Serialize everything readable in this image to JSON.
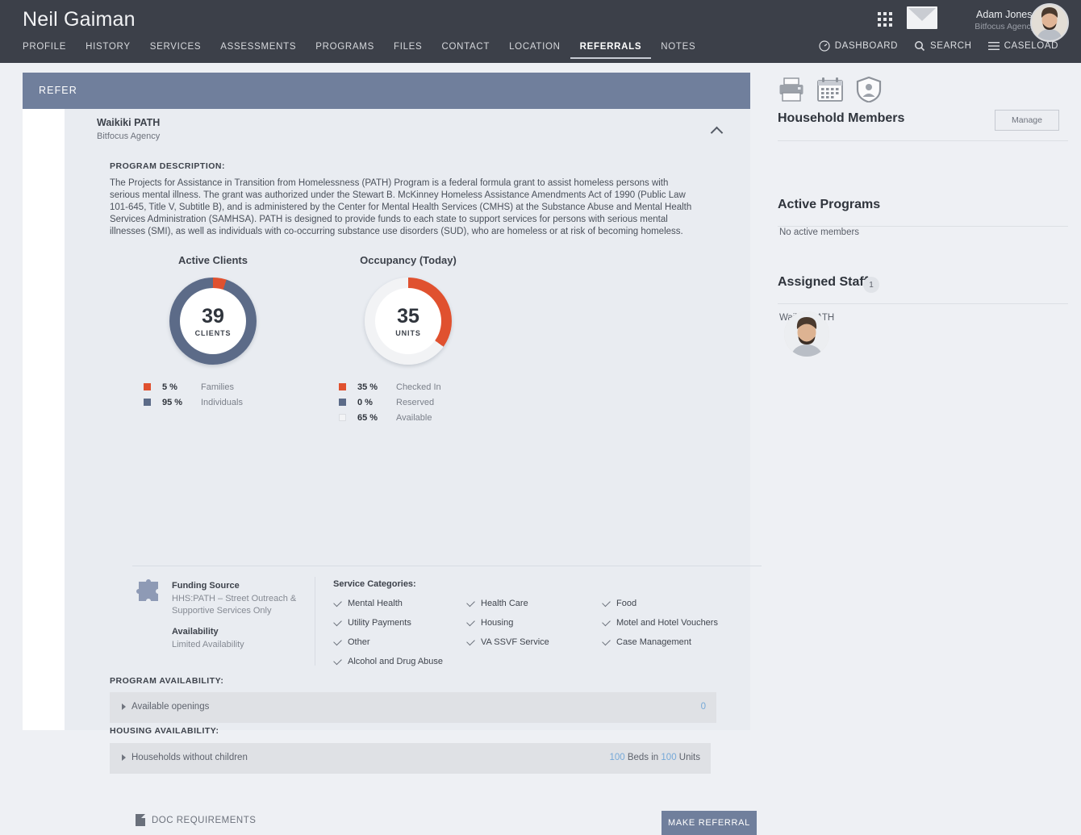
{
  "header": {
    "client_name": "Neil Gaiman",
    "nav": [
      {
        "label": "PROFILE",
        "active": false
      },
      {
        "label": "HISTORY",
        "active": false
      },
      {
        "label": "SERVICES",
        "active": false
      },
      {
        "label": "ASSESSMENTS",
        "active": false
      },
      {
        "label": "PROGRAMS",
        "active": false
      },
      {
        "label": "FILES",
        "active": false
      },
      {
        "label": "CONTACT",
        "active": false
      },
      {
        "label": "LOCATION",
        "active": false
      },
      {
        "label": "REFERRALS",
        "active": true
      },
      {
        "label": "NOTES",
        "active": false
      }
    ],
    "user": {
      "name": "Adam Jones,",
      "agency": "Bitfocus Agency"
    },
    "subnav": [
      {
        "label": "DASHBOARD",
        "icon": "dashboard-gauge-icon"
      },
      {
        "label": "SEARCH",
        "icon": "search-icon"
      },
      {
        "label": "CASELOAD",
        "icon": "hamburger-icon"
      }
    ],
    "icons": {
      "apps": "apps-grid-icon",
      "mail": "mail-envelope-icon",
      "avatar": "user-avatar"
    },
    "colors": {
      "bar_bg": "#3c4049",
      "accent": "#707f9c"
    }
  },
  "refer": {
    "bar_label": "REFER"
  },
  "program": {
    "title": "Waikiki PATH",
    "agency": "Bitfocus Agency",
    "collapse_icon": "chevron-up-icon",
    "description_label": "PROGRAM DESCRIPTION:",
    "description": "The Projects for Assistance in Transition from Homelessness (PATH) Program is a federal formula grant to assist homeless persons with serious mental illness. The grant was authorized under the Stewart B. McKinney Homeless Assistance Amendments Act of 1990 (Public Law 101-645, Title V, Subtitle B), and is administered by the Center for Mental Health Services (CMHS) at the Substance Abuse and Mental Health Services Administration (SAMHSA). PATH is designed to provide funds to each state to support services for persons with serious mental illnesses (SMI), as well as individuals with co-occurring substance use disorders (SUD), who are homeless or at risk of becoming homeless."
  },
  "chart_data": [
    {
      "type": "pie",
      "title": "Active Clients",
      "center_value": "39",
      "center_unit": "CLIENTS",
      "categories": [
        "Families",
        "Individuals"
      ],
      "values": [
        5,
        95
      ],
      "value_labels": [
        "5 %",
        "95 %"
      ],
      "colors": [
        "#e0512f",
        "#5c6b88"
      ],
      "legend": "below",
      "donut": true
    },
    {
      "type": "pie",
      "title": "Occupancy (Today)",
      "center_value": "35",
      "center_unit": "UNITS",
      "categories": [
        "Checked In",
        "Reserved",
        "Available"
      ],
      "values": [
        35,
        0,
        65
      ],
      "value_labels": [
        "35 %",
        "0 %",
        "65 %"
      ],
      "colors": [
        "#e0512f",
        "#5c6b88",
        "#f2f3f5"
      ],
      "legend": "below",
      "donut": true
    }
  ],
  "funding": {
    "icon": "puzzle-piece-icon",
    "source_heading": "Funding Source",
    "source_value": "HHS:PATH – Street Outreach & Supportive Services Only",
    "availability_heading": "Availability",
    "availability_value": "Limited Availability"
  },
  "services": {
    "heading": "Service Categories:",
    "items": [
      "Mental Health",
      "Health Care",
      "Food",
      "Utility Payments",
      "Housing",
      "Motel and Hotel Vouchers",
      "Other",
      "VA SSVF Service",
      "Case Management",
      "Alcohol and Drug Abuse"
    ]
  },
  "program_availability": {
    "label": "PROGRAM AVAILABILITY:",
    "row_label": "Available openings",
    "row_value": "0"
  },
  "housing_availability": {
    "label": "HOUSING AVAILABILITY:",
    "row_label": "Households without children",
    "beds": "100",
    "beds_word": "Beds in",
    "units": "100",
    "units_word": "Units"
  },
  "footer": {
    "doc_requirements": "DOC REQUIREMENTS",
    "doc_icon": "document-icon",
    "make_referral": "MAKE REFERRAL"
  },
  "right_panel": {
    "tool_icons": [
      "printer-icon",
      "calendar-icon",
      "shield-person-icon"
    ],
    "household": {
      "title": "Household Members",
      "manage_label": "Manage",
      "empty_text": "No active members"
    },
    "active_programs": {
      "title": "Active Programs",
      "items": [
        "Waikiki PATH"
      ]
    },
    "assigned_staff": {
      "title": "Assigned Staff",
      "count": "1",
      "avatar": "staff-avatar"
    }
  }
}
